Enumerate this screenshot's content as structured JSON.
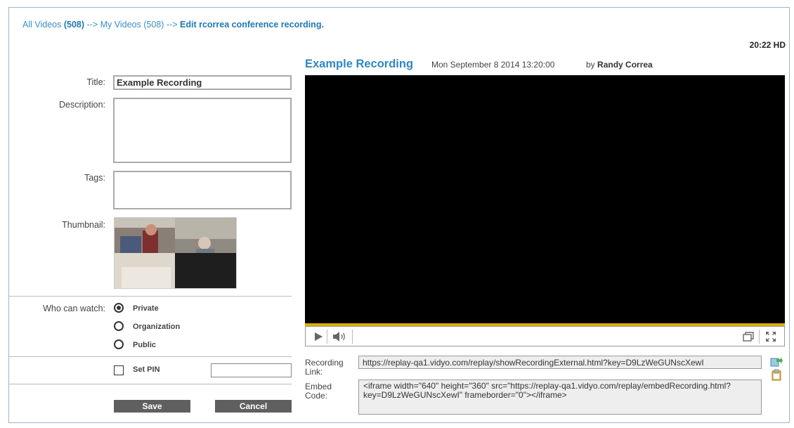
{
  "breadcrumb": {
    "all_videos": "All Videos",
    "all_count": "(508)",
    "sep1": " --> ",
    "my_videos": "My Videos",
    "my_count": "(508)",
    "sep2": " --> ",
    "current": "Edit rcorrea conference recording."
  },
  "duration": "20:22 HD",
  "form": {
    "title_label": "Title:",
    "title_value": "Example Recording",
    "description_label": "Description:",
    "description_value": "",
    "tags_label": "Tags:",
    "tags_value": "",
    "thumbnail_label": "Thumbnail:",
    "who_label": "Who can watch:",
    "options": [
      {
        "label": "Private",
        "selected": true
      },
      {
        "label": "Organization",
        "selected": false
      },
      {
        "label": "Public",
        "selected": false
      }
    ],
    "set_pin_label": "Set PIN",
    "pin_value": "",
    "save_label": "Save",
    "cancel_label": "Cancel"
  },
  "video": {
    "title": "Example Recording",
    "date": "Mon September 8 2014 13:20:00",
    "by_prefix": "by",
    "author": "Randy Correa",
    "progress_color": "#d9b000"
  },
  "links": {
    "recording_label_1": "Recording",
    "recording_label_2": "Link:",
    "recording_url": "https://replay-qa1.vidyo.com/replay/showRecordingExternal.html?key=D9LzWeGUNscXewI",
    "embed_label_1": "Embed",
    "embed_label_2": "Code:",
    "embed_code": "<iframe width=\"640\" height=\"360\" src=\"https://replay-qa1.vidyo.com/replay/embedRecording.html?key=D9LzWeGUNscXewI\" frameborder=\"0\"></iframe>"
  },
  "icons": {
    "play": "play-icon",
    "volume": "volume-icon",
    "popout": "popout-icon",
    "fullscreen": "fullscreen-icon",
    "copy": "copy-link-icon",
    "clipboard": "clipboard-icon"
  }
}
